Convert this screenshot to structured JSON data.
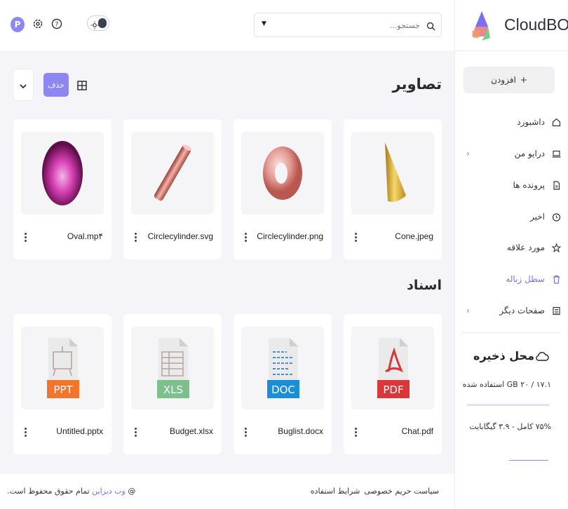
{
  "brand": {
    "name": "CloudBOX"
  },
  "header": {
    "avatar_letter": "P",
    "search_placeholder": "جستجو..."
  },
  "sidebar": {
    "add_label": "افزودن",
    "items": [
      {
        "label": "داشبورد",
        "icon": "home-icon"
      },
      {
        "label": "درایو من",
        "icon": "laptop-icon",
        "has_chevron": true
      },
      {
        "label": "پرونده ها",
        "icon": "file-icon"
      },
      {
        "label": "اخیر",
        "icon": "clock-icon"
      },
      {
        "label": "مورد علاقه",
        "icon": "star-icon"
      },
      {
        "label": "سطل زباله",
        "icon": "trash-icon",
        "active": true
      },
      {
        "label": "صفحات دیگر",
        "icon": "pages-icon",
        "has_chevron": true
      }
    ],
    "storage": {
      "title": "محل ذخیره",
      "used_text": "۱۷.۱ / ۲۰ GB استفاده شده",
      "percent_text": "۷۵% کامل - ۳.۹ گیگابایت",
      "fill_fraction": 0.75
    }
  },
  "main": {
    "images_title": "تصاویر",
    "docs_title": "اسناد",
    "delete_label": "حذف",
    "images": [
      {
        "name": "Cone.jpeg",
        "icon": "cone-image"
      },
      {
        "name": "Circlecylinder.png",
        "icon": "torus-image"
      },
      {
        "name": "Circlecylinder.svg",
        "icon": "cylinder-image"
      },
      {
        "name": "Oval.mp۴",
        "icon": "oval-image"
      }
    ],
    "docs": [
      {
        "name": "Chat.pdf",
        "badge": "PDF",
        "badge_color": "#d9383b"
      },
      {
        "name": "Buglist.docx",
        "badge": "DOC",
        "badge_color": "#1a8fd6"
      },
      {
        "name": "Budget.xlsx",
        "badge": "XLS",
        "badge_color": "#7cc08b"
      },
      {
        "name": "Untitled.pptx",
        "badge": "PPT",
        "badge_color": "#f3742c"
      }
    ]
  },
  "footer": {
    "privacy": "سیاست حریم خصوصی",
    "terms": "شرایط استفاده",
    "copyright_prefix": "@",
    "brand_link": "وب دیزاین",
    "copyright_suffix": "تمام حقوق محفوظ است."
  },
  "colors": {
    "accent": "#8e86f2",
    "active_text": "#7c6cf0"
  }
}
